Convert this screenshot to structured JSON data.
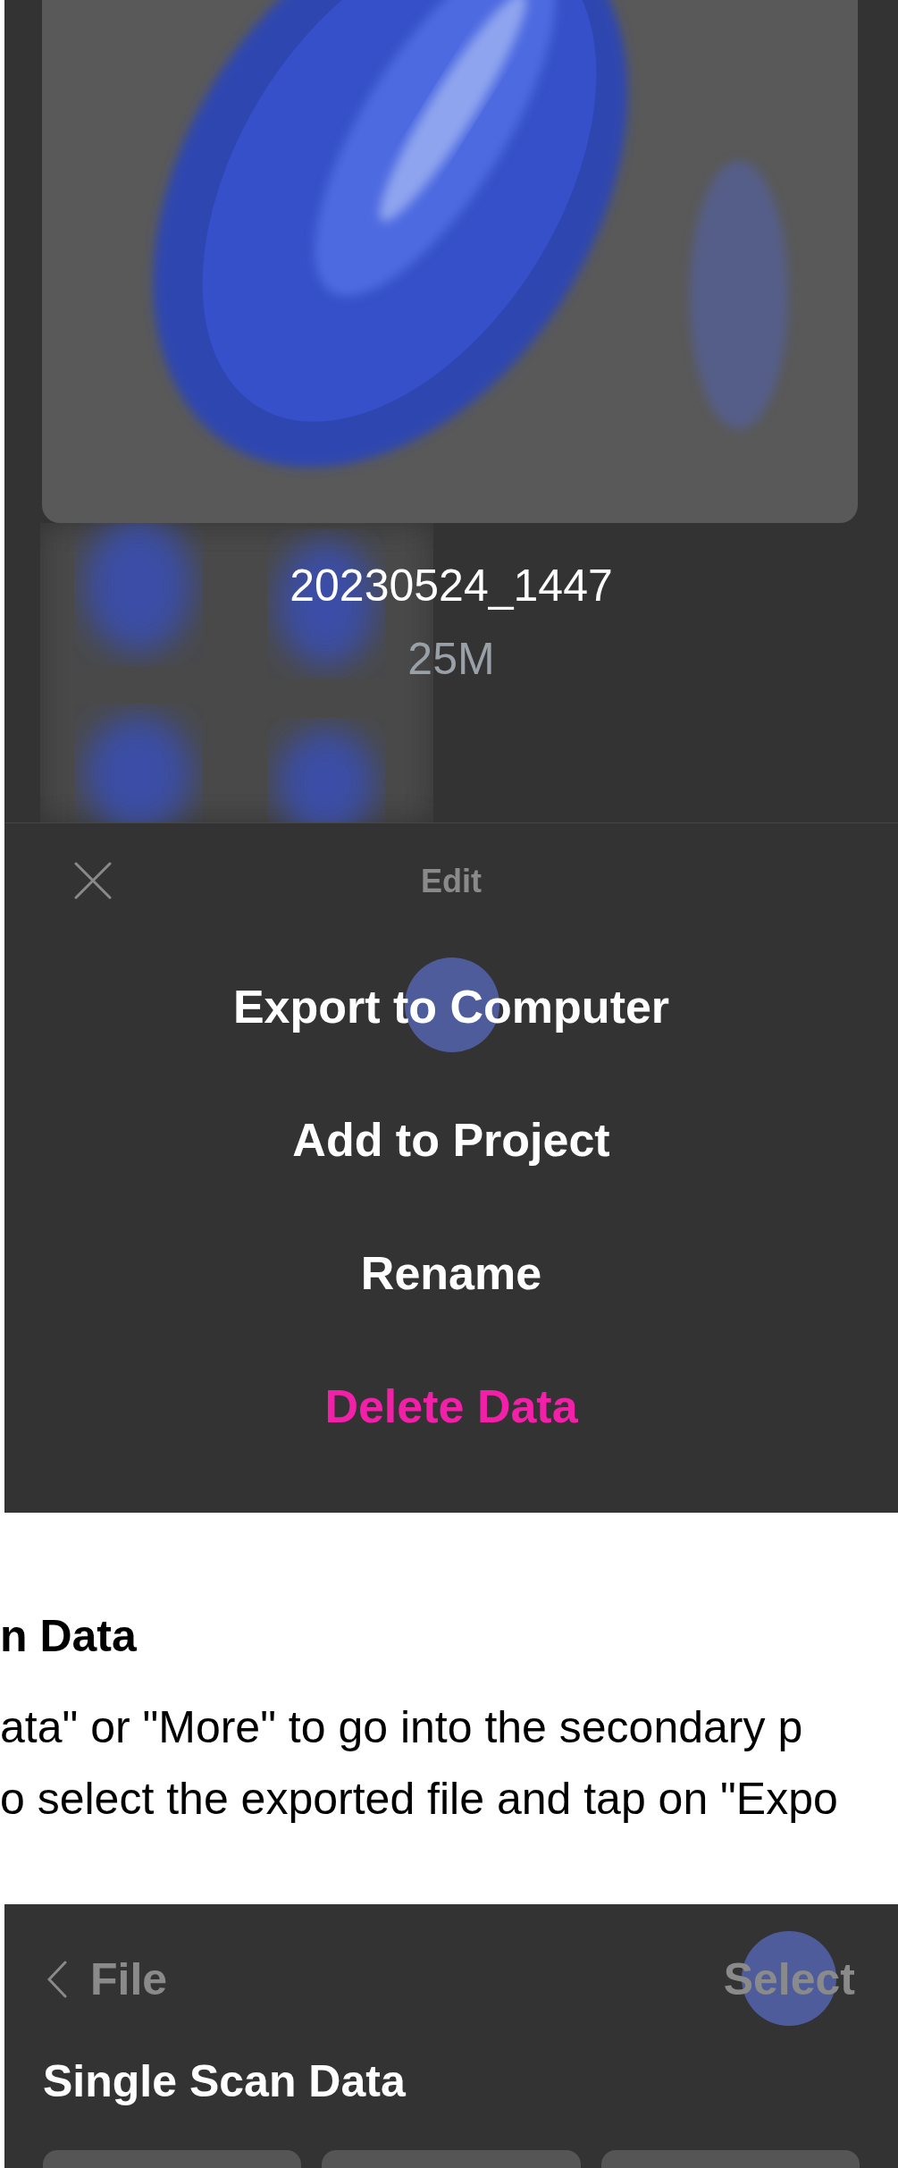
{
  "scan_preview": {
    "file_name": "20230524_1447",
    "file_size": "25M"
  },
  "edit_sheet": {
    "title": "Edit",
    "items": [
      {
        "label": "Export to Computer",
        "kind": "normal"
      },
      {
        "label": "Add to Project",
        "kind": "normal"
      },
      {
        "label": "Rename",
        "kind": "normal"
      },
      {
        "label": "Delete Data",
        "kind": "danger"
      }
    ]
  },
  "article": {
    "heading": "n Data",
    "lines": [
      "ata\" or \"More\" to go into the secondary p",
      "o select the exported file and tap on \"Expo"
    ]
  },
  "file_screen": {
    "back_label": "File",
    "action": "Select",
    "section_title": "Single Scan Data"
  }
}
